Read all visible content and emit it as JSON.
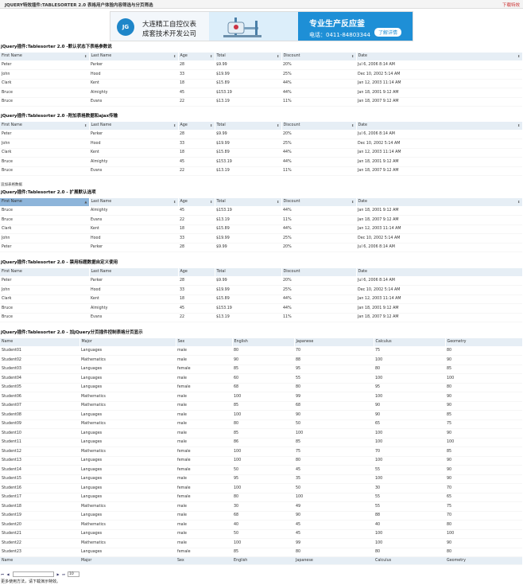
{
  "topbar": {
    "title": "JQUERY特效插件:TABLESORTER 2.0 表格用户体验内容筛选与分页筛选",
    "download": "下载特效"
  },
  "banner": {
    "logo": "JG",
    "name1": "大连精工自控仪表",
    "name2": "成套技术开发公司",
    "slogan": "专业生产反应釜",
    "phone": "电话：0411-84803344",
    "button": "了解详情"
  },
  "person_headers": [
    "First Name",
    "Last Name",
    "Age",
    "Total",
    "Discount",
    "Date"
  ],
  "person_rows": [
    [
      "Peter",
      "Parker",
      "28",
      "$9.99",
      "20%",
      "Jul 6, 2006 8:14 AM"
    ],
    [
      "John",
      "Hood",
      "33",
      "$19.99",
      "25%",
      "Dec 10, 2002 5:14 AM"
    ],
    [
      "Clark",
      "Kent",
      "18",
      "$15.89",
      "44%",
      "Jan 12, 2003 11:14 AM"
    ],
    [
      "Bruce",
      "Almighty",
      "45",
      "$153.19",
      "44%",
      "Jan 18, 2001 9:12 AM"
    ],
    [
      "Bruce",
      "Evans",
      "22",
      "$13.19",
      "11%",
      "Jan 18, 2007 9:12 AM"
    ]
  ],
  "person_rows_sorted": [
    [
      "Bruce",
      "Almighty",
      "45",
      "$153.19",
      "44%",
      "Jan 18, 2001 9:12 AM"
    ],
    [
      "Bruce",
      "Evans",
      "22",
      "$13.19",
      "11%",
      "Jan 18, 2007 9:12 AM"
    ],
    [
      "Clark",
      "Kent",
      "18",
      "$15.89",
      "44%",
      "Jan 12, 2003 11:14 AM"
    ],
    [
      "John",
      "Hood",
      "33",
      "$19.99",
      "25%",
      "Dec 10, 2002 5:14 AM"
    ],
    [
      "Peter",
      "Parker",
      "28",
      "$9.99",
      "20%",
      "Jul 6, 2006 8:14 AM"
    ]
  ],
  "sections": [
    "jQuery插件:Tablesorter 2.0 -默认状态下表格参数说",
    "jQuery插件:Tablesorter 2.0 -附加表格数据和ajax传输",
    "jQuery插件:Tablesorter 2.0 - 扩展默认选项",
    "jQuery插件:Tablesorter 2.0 - 禁用标题数据自定义使用",
    "jQuery插件:Tablesorter 2.0 - 加jQuery分页插件控制表格分页显示"
  ],
  "append_hint": "追加表格数据",
  "student_headers": [
    "Name",
    "Major",
    "Sex",
    "English",
    "Japanese",
    "Calculus",
    "Geometry"
  ],
  "students": [
    [
      "Student01",
      "Languages",
      "male",
      "80",
      "70",
      "75",
      "80"
    ],
    [
      "Student02",
      "Mathematics",
      "male",
      "90",
      "88",
      "100",
      "90"
    ],
    [
      "Student03",
      "Languages",
      "female",
      "85",
      "95",
      "80",
      "85"
    ],
    [
      "Student04",
      "Languages",
      "male",
      "60",
      "55",
      "100",
      "100"
    ],
    [
      "Student05",
      "Languages",
      "female",
      "68",
      "80",
      "95",
      "80"
    ],
    [
      "Student06",
      "Mathematics",
      "male",
      "100",
      "99",
      "100",
      "90"
    ],
    [
      "Student07",
      "Mathematics",
      "male",
      "85",
      "68",
      "90",
      "90"
    ],
    [
      "Student08",
      "Languages",
      "male",
      "100",
      "90",
      "90",
      "85"
    ],
    [
      "Student09",
      "Mathematics",
      "male",
      "80",
      "50",
      "65",
      "75"
    ],
    [
      "Student10",
      "Languages",
      "male",
      "85",
      "100",
      "100",
      "90"
    ],
    [
      "Student11",
      "Languages",
      "male",
      "86",
      "85",
      "100",
      "100"
    ],
    [
      "Student12",
      "Mathematics",
      "female",
      "100",
      "75",
      "70",
      "85"
    ],
    [
      "Student13",
      "Languages",
      "female",
      "100",
      "80",
      "100",
      "90"
    ],
    [
      "Student14",
      "Languages",
      "female",
      "50",
      "45",
      "55",
      "90"
    ],
    [
      "Student15",
      "Languages",
      "male",
      "95",
      "35",
      "100",
      "90"
    ],
    [
      "Student16",
      "Languages",
      "female",
      "100",
      "50",
      "30",
      "70"
    ],
    [
      "Student17",
      "Languages",
      "female",
      "80",
      "100",
      "55",
      "65"
    ],
    [
      "Student18",
      "Mathematics",
      "male",
      "30",
      "49",
      "55",
      "75"
    ],
    [
      "Student19",
      "Languages",
      "male",
      "68",
      "90",
      "88",
      "70"
    ],
    [
      "Student20",
      "Mathematics",
      "male",
      "40",
      "45",
      "40",
      "80"
    ],
    [
      "Student21",
      "Languages",
      "male",
      "50",
      "45",
      "100",
      "100"
    ],
    [
      "Student22",
      "Mathematics",
      "male",
      "100",
      "99",
      "100",
      "90"
    ],
    [
      "Student23",
      "Languages",
      "female",
      "85",
      "80",
      "80",
      "80"
    ]
  ],
  "pager": {
    "page_size": "10"
  },
  "footer_note": "更多使用方法，请下载演示特效。"
}
